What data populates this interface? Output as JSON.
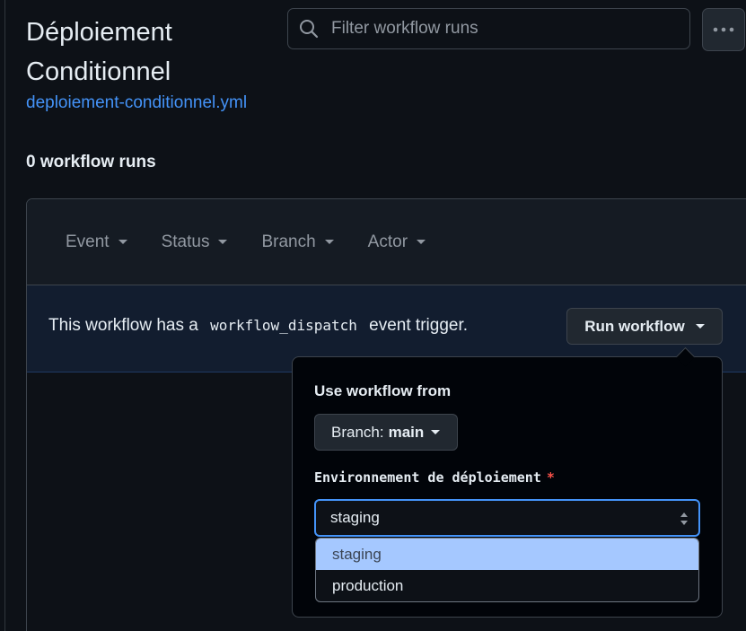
{
  "header": {
    "title": "Déploiement Conditionnel",
    "file_link": "deploiement-conditionnel.yml"
  },
  "search": {
    "placeholder": "Filter workflow runs"
  },
  "runs_count": "0 workflow runs",
  "filters": [
    "Event",
    "Status",
    "Branch",
    "Actor"
  ],
  "dispatch": {
    "text_before": "This workflow has a",
    "code": "workflow_dispatch",
    "text_after": "event trigger.",
    "run_button": "Run workflow"
  },
  "popover": {
    "use_from_label": "Use workflow from",
    "branch_prefix": "Branch:",
    "branch_value": "main",
    "env_label": "Environnement de déploiement",
    "required_mark": "*",
    "selected_value": "staging",
    "options": [
      "staging",
      "production"
    ]
  },
  "colors": {
    "background": "#0d1117",
    "link": "#4493f8",
    "focus_border": "#4493f8",
    "required": "#f85149",
    "option_highlight": "#a5c8ff"
  },
  "icons": {
    "search": "search-icon",
    "more": "kebab-horizontal-icon"
  }
}
